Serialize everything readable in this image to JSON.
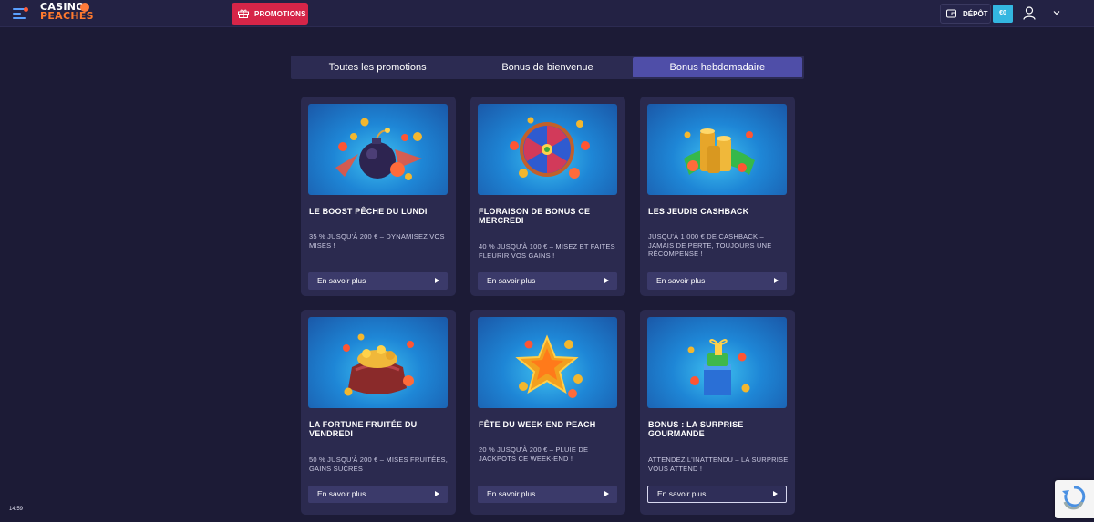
{
  "header": {
    "logo_line1": "CASINO",
    "logo_line2": "PEACHES",
    "promotions_label": "PROMOTIONS",
    "deposit_label": "DÉPÔT",
    "balance": "€0",
    "colors": {
      "promotions": "#d62548",
      "balance": "#33b6e0",
      "accent": "#4f4ea8"
    }
  },
  "tabs": [
    {
      "label": "Toutes les promotions",
      "active": false
    },
    {
      "label": "Bonus de bienvenue",
      "active": false
    },
    {
      "label": "Bonus hebdomadaire",
      "active": true
    }
  ],
  "cards": [
    {
      "title": "LE BOOST PÊCHE DU LUNDI",
      "desc": "35 % JUSQU'À 200 € – DYNAMISEZ VOS MISES !",
      "cta": "En savoir plus",
      "icon": "bomb-peach-icon"
    },
    {
      "title": "FLORAISON DE BONUS CE MERCREDI",
      "desc": "40 % JUSQU'À 100 € – MISEZ ET FAITES FLEURIR VOS GAINS !",
      "cta": "En savoir plus",
      "icon": "wheel-of-fortune-icon"
    },
    {
      "title": "LES JEUDIS CASHBACK",
      "desc": "JUSQU'À 1 000 € DE CASHBACK – JAMAIS DE PERTE, TOUJOURS UNE RÉCOMPENSE !",
      "cta": "En savoir plus",
      "icon": "coin-stack-icon"
    },
    {
      "title": "LA FORTUNE FRUITÉE DU VENDREDI",
      "desc": "50 % JUSQU'À 200 € – MISES FRUITÉES, GAINS SUCRÉS !",
      "cta": "En savoir plus",
      "icon": "treasure-sack-icon"
    },
    {
      "title": "FÊTE DU WEEK-END PEACH",
      "desc": "20 % JUSQU'À 200 € – PLUIE DE JACKPOTS CE WEEK-END !",
      "cta": "En savoir plus",
      "icon": "star-icon"
    },
    {
      "title": "BONUS : LA SURPRISE GOURMANDE",
      "desc": "ATTENDEZ L'INATTENDU – LA SURPRISE VOUS ATTEND !",
      "cta": "En savoir plus",
      "icon": "gift-box-icon"
    }
  ],
  "clock": "14:59"
}
